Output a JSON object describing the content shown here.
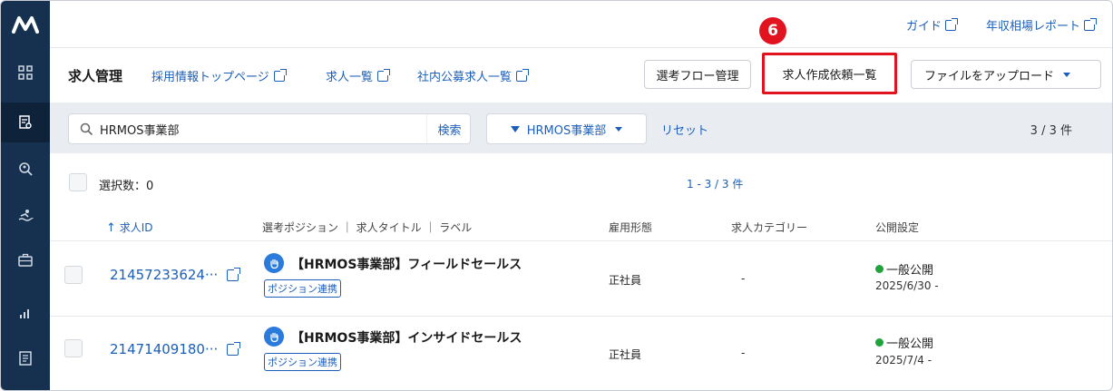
{
  "logo": "ʍ",
  "topbar": {
    "guide": "ガイド",
    "salary_report": "年収相場レポート"
  },
  "step_badge": "6",
  "nav": {
    "title": "求人管理",
    "links": [
      "採用情報トップページ",
      "求人一覧",
      "社内公募求人一覧"
    ],
    "buttons": {
      "flow": "選考フロー管理",
      "requests": "求人作成依頼一覧",
      "upload": "ファイルをアップロード"
    }
  },
  "filter": {
    "search_value": "HRMOS事業部",
    "search_button": "検索",
    "filter_label": "HRMOS事業部",
    "reset": "リセット",
    "count": "3 / 3 件"
  },
  "selection": {
    "label": "選択数：0",
    "pager": "1 - 3 / 3 件"
  },
  "table": {
    "headers": {
      "id": "求人ID",
      "position": "選考ポジション ｜ 求人タイトル ｜ ラベル",
      "employment": "雇用形態",
      "category": "求人カテゴリー",
      "publish": "公開設定"
    },
    "rows": [
      {
        "id": "21457233624···",
        "title": "【HRMOS事業部】フィールドセールス",
        "tag": "ポジション連携",
        "employment": "正社員",
        "category": "-",
        "status": "一般公開",
        "date": "2025/6/30 -"
      },
      {
        "id": "21471409180···",
        "title": "【HRMOS事業部】インサイドセールス",
        "tag": "ポジション連携",
        "employment": "正社員",
        "category": "-",
        "status": "一般公開",
        "date": "2025/7/4 -"
      }
    ]
  },
  "colors": {
    "sidebar": "#16304f",
    "link": "#1d5fb8",
    "highlight": "#e0131f",
    "published": "#1fa33a"
  }
}
